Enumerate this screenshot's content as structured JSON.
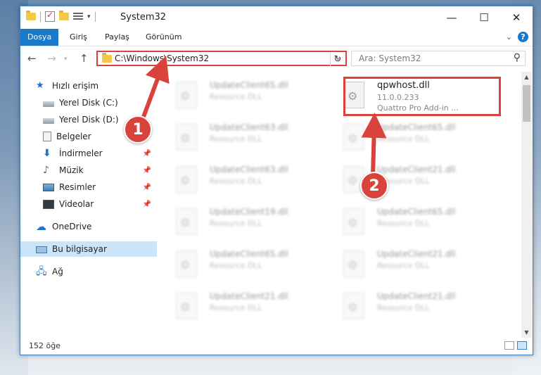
{
  "window": {
    "title": "System32"
  },
  "ribbon": {
    "tabs": [
      "Dosya",
      "Giriş",
      "Paylaş",
      "Görünüm"
    ],
    "help": "?"
  },
  "nav": {
    "address": "C:\\Windows\\System32",
    "search_placeholder": "Ara: System32"
  },
  "sidebar": {
    "items": [
      {
        "label": "Hızlı erişim",
        "icon": "star-icon"
      },
      {
        "label": "Yerel Disk (C:)",
        "icon": "drive-icon"
      },
      {
        "label": "Yerel Disk (D:)",
        "icon": "drive-icon"
      },
      {
        "label": "Belgeler",
        "icon": "documents-icon"
      },
      {
        "label": "İndirmeler",
        "icon": "download-icon"
      },
      {
        "label": "Müzik",
        "icon": "music-icon"
      },
      {
        "label": "Resimler",
        "icon": "pictures-icon"
      },
      {
        "label": "Videolar",
        "icon": "videos-icon"
      },
      {
        "label": "OneDrive",
        "icon": "cloud-icon"
      },
      {
        "label": "Bu bilgisayar",
        "icon": "computer-icon"
      },
      {
        "label": "Ağ",
        "icon": "network-icon"
      }
    ]
  },
  "files": {
    "selected": {
      "name": "qpwhost.dll",
      "version": "11.0.0.233",
      "description": "Quattro Pro Add-in ..."
    },
    "left_column": [
      {
        "name": "UpdateClient65.dll",
        "type": "Resource DLL"
      },
      {
        "name": "UpdateClient63.dll",
        "type": "Resource DLL"
      },
      {
        "name": "UpdateClient63.dll",
        "type": "Resource DLL"
      },
      {
        "name": "UpdateClient19.dll",
        "type": "Resource DLL"
      },
      {
        "name": "UpdateClient65.dll",
        "type": "Resource DLL"
      },
      {
        "name": "UpdateClient21.dll",
        "type": "Resource DLL"
      }
    ],
    "right_column": [
      {
        "name": "UpdateClient65.dll",
        "type": "Resource DLL"
      },
      {
        "name": "UpdateClient21.dll",
        "type": "Resource DLL"
      },
      {
        "name": "UpdateClient65.dll",
        "type": "Resource DLL"
      },
      {
        "name": "UpdateClient21.dll",
        "type": "Resource DLL"
      },
      {
        "name": "UpdateClient21.dll",
        "type": "Resource DLL"
      }
    ]
  },
  "status": {
    "count": "152 öğe"
  },
  "annotations": {
    "badge1": "1",
    "badge2": "2",
    "color": "#d9433b"
  }
}
